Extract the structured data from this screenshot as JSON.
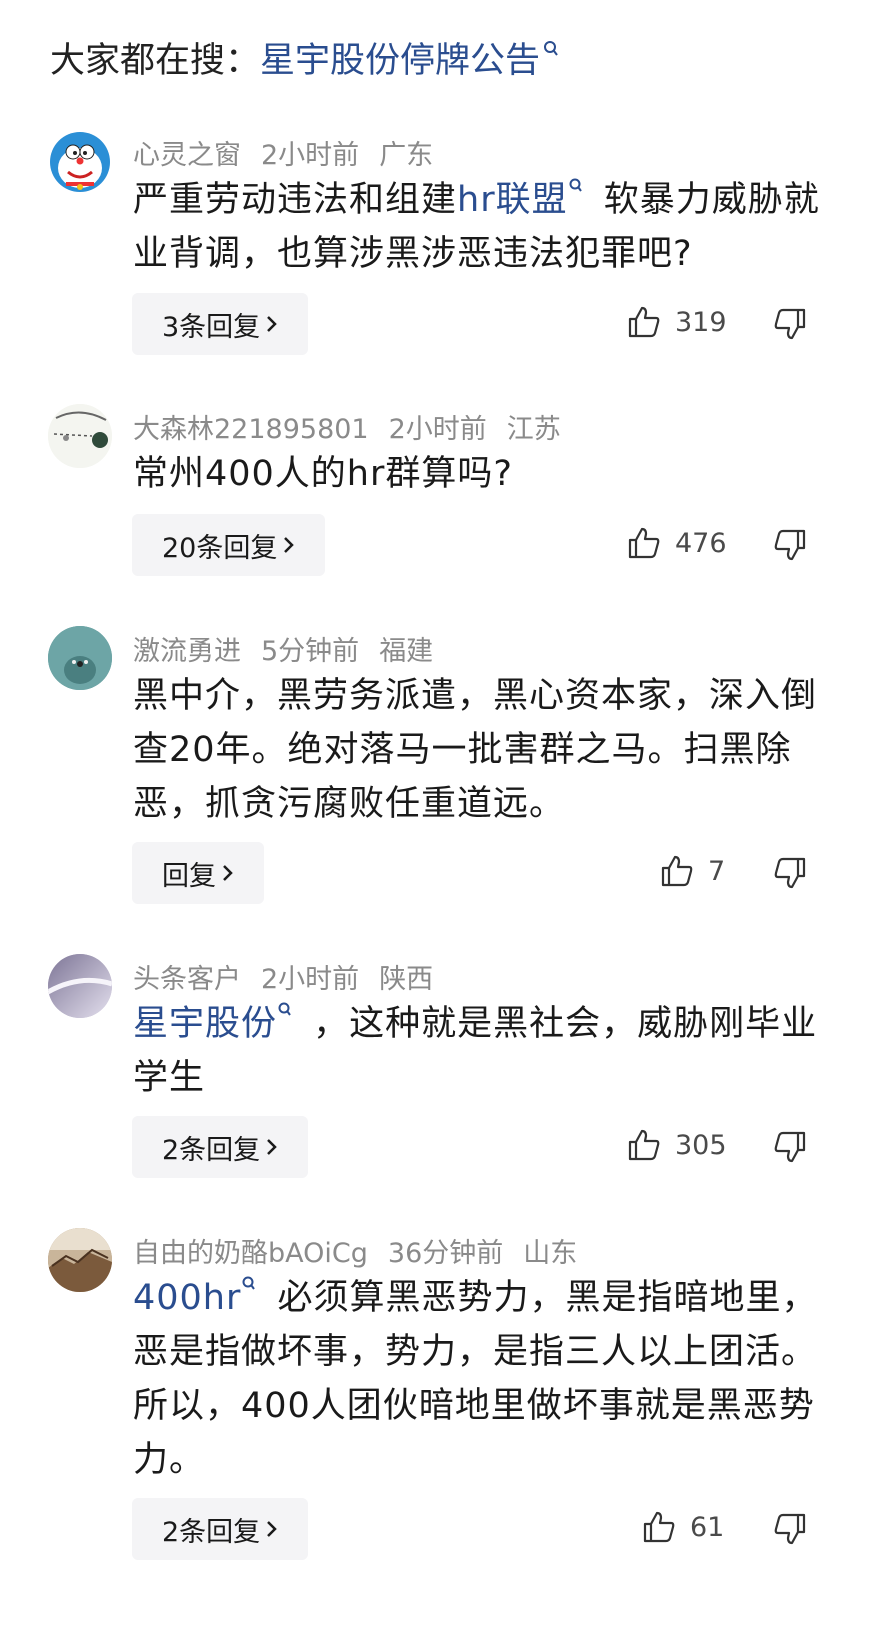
{
  "search": {
    "prefix": "大家都在搜：",
    "query": "星宇股份停牌公告"
  },
  "comments": [
    {
      "user": "心灵之窗",
      "time": "2小时前",
      "location": "广东",
      "link_text": "",
      "text_parts": [
        "严重劳动违法和组建",
        "hr联盟",
        " 软暴力威胁就业背调，也算涉黑涉恶违法犯罪吧?"
      ],
      "reply_label": "3条回复",
      "likes": "319"
    },
    {
      "user": "大森林221895801",
      "time": "2小时前",
      "location": "江苏",
      "text_parts": [
        "常州400人的hr群算吗?"
      ],
      "reply_label": "20条回复",
      "likes": "476"
    },
    {
      "user": "激流勇进",
      "time": "5分钟前",
      "location": "福建",
      "text_parts": [
        "黑中介，黑劳务派遣，黑心资本家，深入倒查20年。绝对落马一批害群之马。扫黑除恶，抓贪污腐败任重道远。"
      ],
      "reply_label": "回复",
      "likes": "7"
    },
    {
      "user": "头条客户",
      "time": "2小时前",
      "location": "陕西",
      "text_parts": [
        "星宇股份",
        " ，这种就是黑社会，威胁刚毕业学生"
      ],
      "reply_label": "2条回复",
      "likes": "305"
    },
    {
      "user": "自由的奶酪bAOiCg",
      "time": "36分钟前",
      "location": "山东",
      "text_parts": [
        "400hr",
        " 必须算黑恶势力，黑是指暗地里，恶是指做坏事，势力，是指三人以上团活。所以，400人团伙暗地里做坏事就是黑恶势力。"
      ],
      "reply_label": "2条回复",
      "likes": "61"
    }
  ],
  "colors": {
    "link": "#2a4d8f",
    "meta": "#8a8a8a",
    "reply_bg": "#f4f4f6"
  }
}
